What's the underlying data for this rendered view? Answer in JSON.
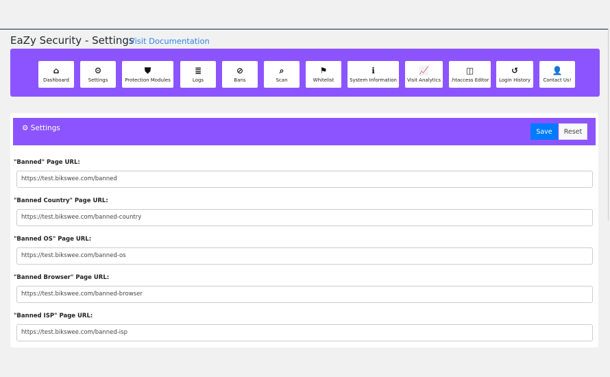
{
  "header": {
    "title": "EaZy Security - Settings",
    "doc_link": "Visit Documentation"
  },
  "nav": [
    {
      "label": "Dashboard",
      "icon": "home-icon",
      "glyph": "⌂"
    },
    {
      "label": "Settings",
      "icon": "cogs-icon",
      "glyph": "⚙"
    },
    {
      "label": "Protection Modules",
      "icon": "shield-icon",
      "glyph": "⛊"
    },
    {
      "label": "Logs",
      "icon": "list-icon",
      "glyph": "≣"
    },
    {
      "label": "Bans",
      "icon": "ban-icon",
      "glyph": "⊘"
    },
    {
      "label": "Scan",
      "icon": "search-icon",
      "glyph": "⌕"
    },
    {
      "label": "Whitelist",
      "icon": "flag-icon",
      "glyph": "⚑"
    },
    {
      "label": "System Information",
      "icon": "info-icon",
      "glyph": "ℹ"
    },
    {
      "label": "Visit Analytics",
      "icon": "chart-line-icon",
      "glyph": "📈"
    },
    {
      "label": ".htaccess Editor",
      "icon": "columns-icon",
      "glyph": "◫"
    },
    {
      "label": "Login History",
      "icon": "history-icon",
      "glyph": "↺"
    },
    {
      "label": "Contact Us!",
      "icon": "user-icon",
      "glyph": "👤"
    }
  ],
  "card": {
    "title": "Settings",
    "icon": "cog-icon",
    "glyph": "⚙",
    "save": "Save",
    "reset": "Reset"
  },
  "fields": [
    {
      "label": "\"Banned\" Page URL:",
      "value": "https://test.bikswee.com/banned"
    },
    {
      "label": "\"Banned Country\" Page URL:",
      "value": "https://test.bikswee.com/banned-country"
    },
    {
      "label": "\"Banned OS\" Page URL:",
      "value": "https://test.bikswee.com/banned-os"
    },
    {
      "label": "\"Banned Browser\" Page URL:",
      "value": "https://test.bikswee.com/banned-browser"
    },
    {
      "label": "\"Banned ISP\" Page URL:",
      "value": "https://test.bikswee.com/banned-isp"
    }
  ],
  "colors": {
    "accent": "#8c54ff",
    "primary": "#007bff",
    "link": "#2f86ea"
  }
}
